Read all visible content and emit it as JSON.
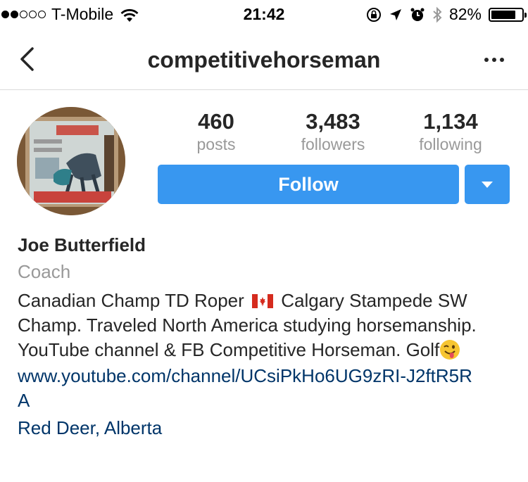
{
  "status_bar": {
    "carrier": "T-Mobile",
    "signal_strength": 2,
    "signal_max": 5,
    "time": "21:42",
    "battery_percent": "82%",
    "battery_level": 0.82,
    "icons": [
      "wifi-icon",
      "rotation-lock-icon",
      "location-arrow-icon",
      "alarm-icon",
      "bluetooth-icon",
      "battery-icon"
    ]
  },
  "nav": {
    "title": "competitivehorseman",
    "back_icon": "chevron-left-icon",
    "more_icon": "more-dots-icon"
  },
  "profile": {
    "stats": [
      {
        "value": "460",
        "label": "posts"
      },
      {
        "value": "3,483",
        "label": "followers"
      },
      {
        "value": "1,134",
        "label": "following"
      }
    ],
    "follow_label": "Follow",
    "dropdown_icon": "caret-down-icon",
    "accent_color": "#3897f0"
  },
  "bio": {
    "full_name": "Joe Butterfield",
    "category": "Coach",
    "text_part1": "Canadian Champ TD Roper",
    "text_part2": "Calgary Stampede SW Champ. Traveled North America studying horsemanship. YouTube channel & FB Competitive Horseman. Golf",
    "flag_icon": "canada-flag-icon",
    "emoji_icon": "winking-tongue-emoji-icon",
    "website": "www.youtube.com/channel/UCsiPkHo6UG9zRI-J2ftR5RA",
    "location": "Red Deer, Alberta",
    "link_color": "#003569"
  }
}
